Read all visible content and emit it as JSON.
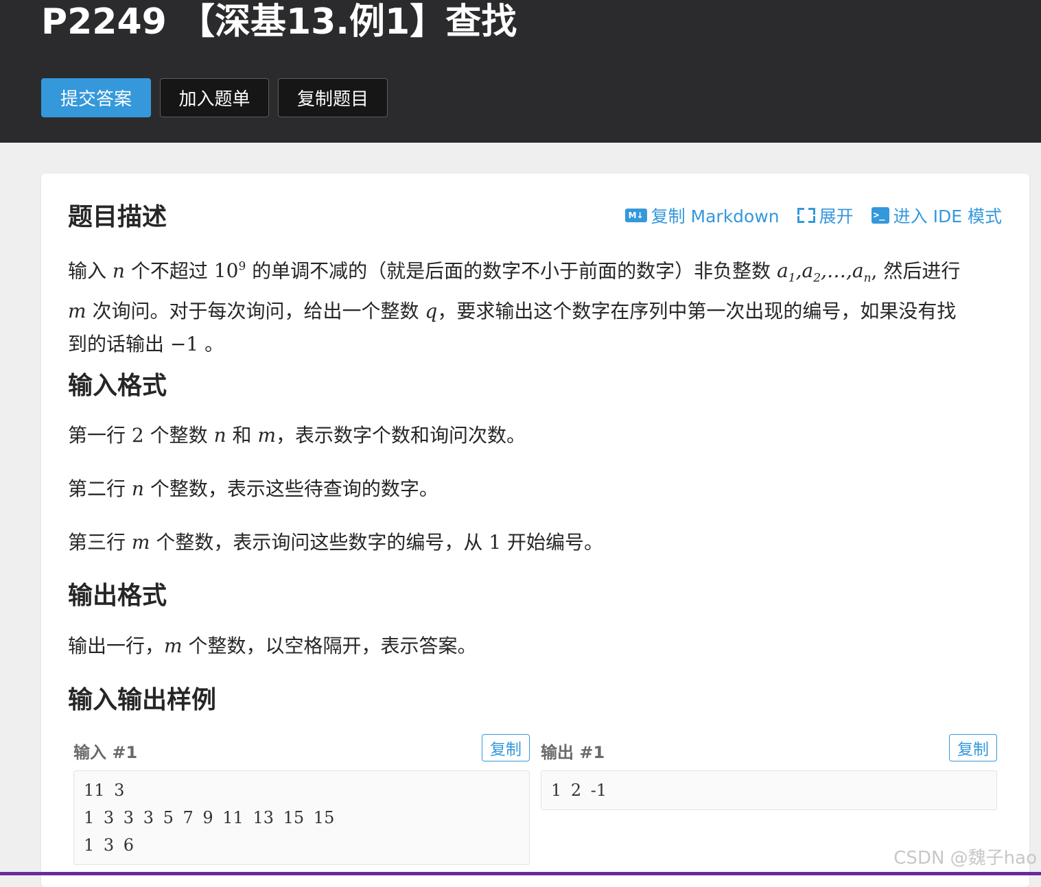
{
  "header": {
    "title": "P2249 【深基13.例1】查找",
    "buttons": {
      "submit": "提交答案",
      "add_list": "加入题单",
      "copy_problem": "复制题目"
    }
  },
  "actions": {
    "copy_markdown": "复制 Markdown",
    "expand": "展开",
    "ide_mode": "进入 IDE 模式",
    "md_icon_text": "M↓",
    "term_icon_text": ">_"
  },
  "description": {
    "heading": "题目描述",
    "p1": "输入",
    "n": "n",
    "p2": "个不超过",
    "pow_base": "10",
    "pow_exp": "9",
    "p3": "的单调不减的（就是后面的数字不小于前面的数字）非负整数",
    "seq_a": "a",
    "sub1": "1",
    "sub2": "2",
    "subn": "n",
    "comma": ",",
    "dots": "…",
    "p4": "然后进行",
    "m": "m",
    "p5": "次询问。对于每次询问，给出一个整数",
    "q": "q",
    "p6": "，要求输出这个数字在序列中第一次出现的编号，如果没有找到的话输出",
    "neg1": "−1",
    "p7": "。"
  },
  "input_format": {
    "heading": "输入格式",
    "l1_a": "第一行",
    "l1_two": "2",
    "l1_b": "个整数",
    "l1_n": "n",
    "l1_c": "和",
    "l1_m": "m",
    "l1_d": "，表示数字个数和询问次数。",
    "l2_a": "第二行",
    "l2_n": "n",
    "l2_b": "个整数，表示这些待查询的数字。",
    "l3_a": "第三行",
    "l3_m": "m",
    "l3_b": "个整数，表示询问这些数字的编号，从",
    "l3_one": "1",
    "l3_c": "开始编号。"
  },
  "output_format": {
    "heading": "输出格式",
    "l1_a": "输出一行，",
    "l1_m": "m",
    "l1_b": "个整数，以空格隔开，表示答案。"
  },
  "samples": {
    "heading": "输入输出样例",
    "input_label": "输入 #1",
    "output_label": "输出 #1",
    "copy_label": "复制",
    "input_lines": [
      "11 3",
      "1 3 3 3 5 7 9 11 13 15 15",
      "1 3 6"
    ],
    "output_lines": [
      "1 2 -1"
    ]
  },
  "watermark": "CSDN @魏子hao",
  "colors": {
    "header_bg": "#2b2b2d",
    "primary": "#3498db",
    "page_bg": "#efefef",
    "bottom_bar": "#6a2a9a"
  }
}
